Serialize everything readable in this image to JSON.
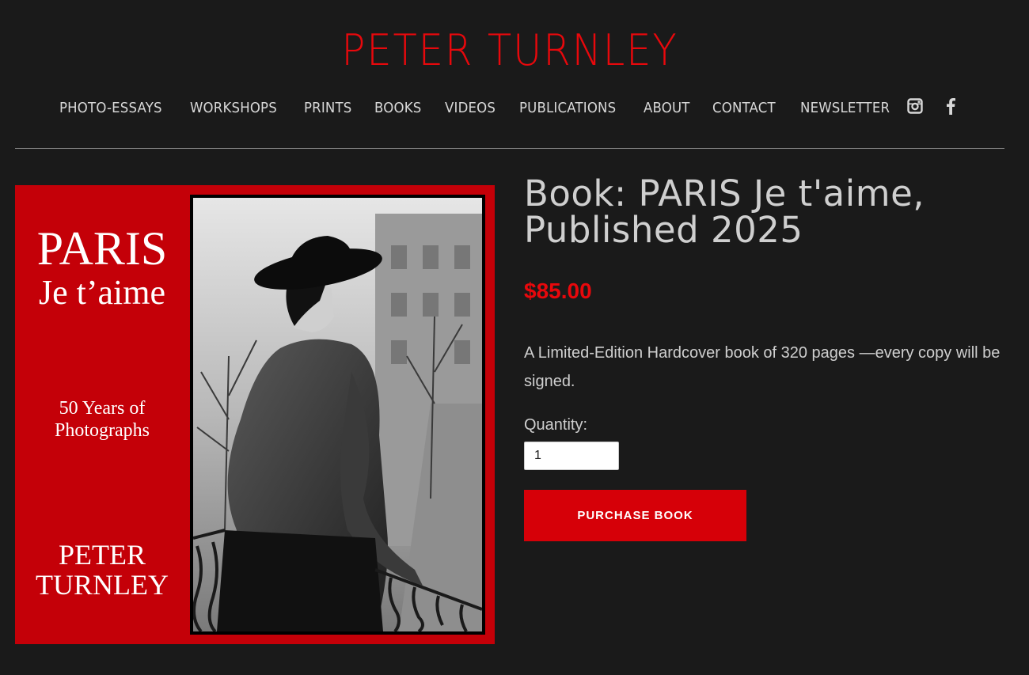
{
  "site": {
    "title": "PETER TURNLEY"
  },
  "nav": {
    "items": [
      {
        "label": "PHOTO-ESSAYS"
      },
      {
        "label": "WORKSHOPS"
      },
      {
        "label": "PRINTS"
      },
      {
        "label": "BOOKS"
      },
      {
        "label": "VIDEOS"
      },
      {
        "label": "PUBLICATIONS"
      },
      {
        "label": "ABOUT"
      },
      {
        "label": "CONTACT"
      },
      {
        "label": "NEWSLETTER"
      }
    ],
    "social": [
      {
        "icon": "instagram-icon"
      },
      {
        "icon": "facebook-icon"
      }
    ]
  },
  "cover": {
    "title_line1": "PARIS",
    "title_line2": "Je t’aime",
    "subtitle_line1": "50 Years of",
    "subtitle_line2": "Photographs",
    "author_line1": "PETER",
    "author_line2": "TURNLEY",
    "background_color": "#c40008"
  },
  "product": {
    "title": "Book: PARIS Je t'aime, Published 2025",
    "price": "$85.00",
    "description": "A Limited-Edition Hardcover book of 320 pages —every copy will be signed.",
    "quantity_label": "Quantity:",
    "quantity_value": "1",
    "purchase_label": "PURCHASE BOOK"
  },
  "colors": {
    "accent": "#e8080c",
    "background": "#1a1a1a",
    "text": "#cfcfcf"
  }
}
